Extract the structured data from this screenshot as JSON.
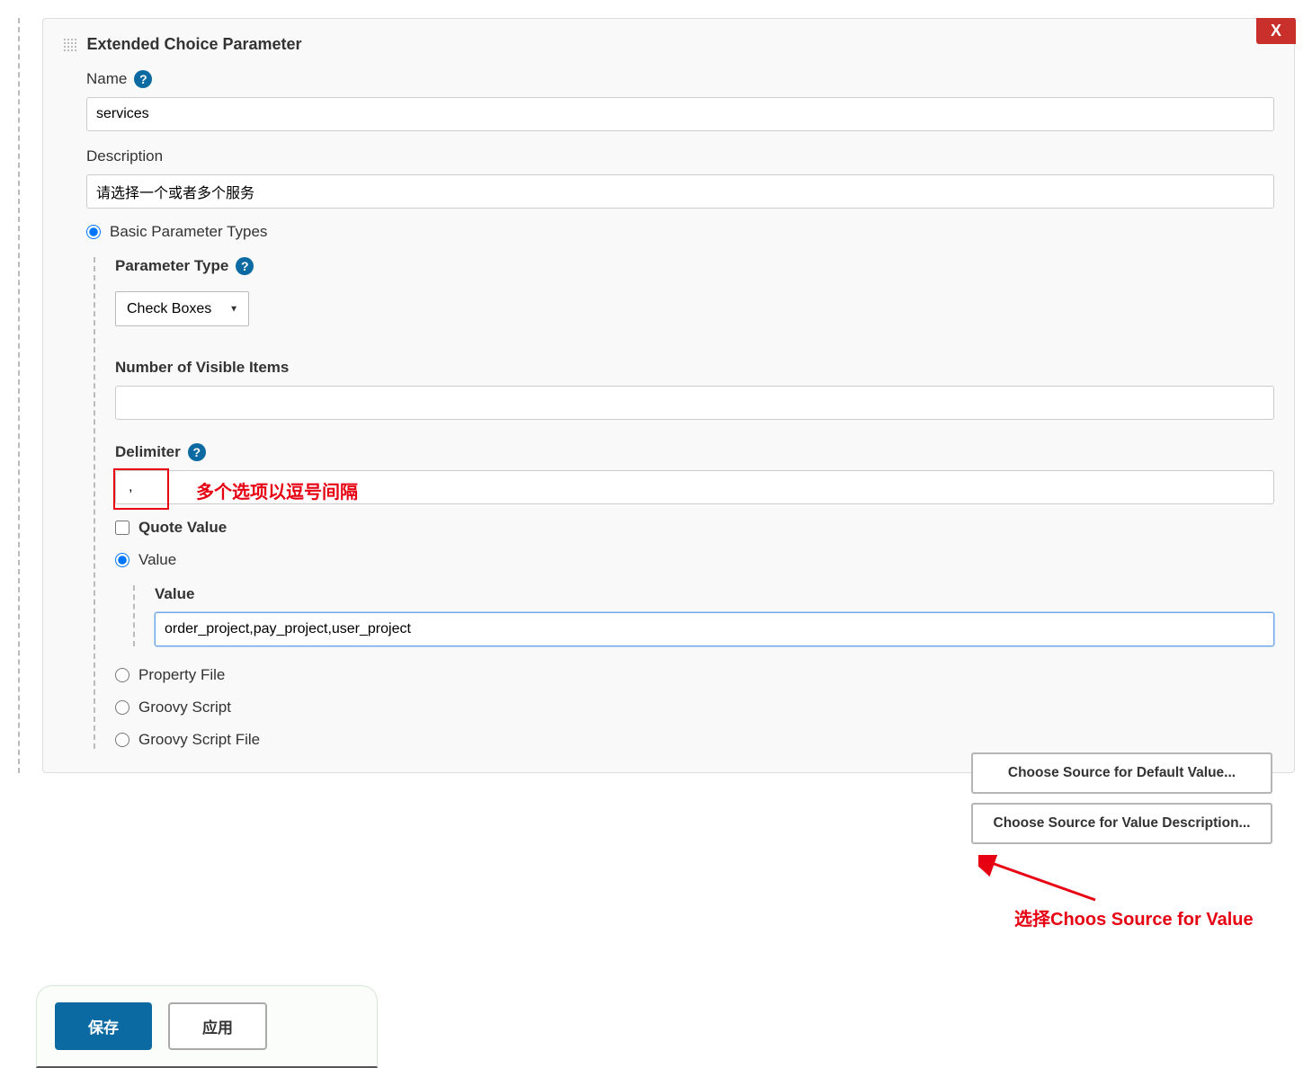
{
  "panel": {
    "title": "Extended Choice Parameter",
    "close": "X"
  },
  "fields": {
    "name_label": "Name",
    "name_value": "services",
    "description_label": "Description",
    "description_value": "请选择一个或者多个服务",
    "basic_parameter_types": "Basic Parameter Types",
    "parameter_type_label": "Parameter Type",
    "parameter_type_value": "Check Boxes",
    "num_visible_label": "Number of Visible Items",
    "num_visible_value": "",
    "delimiter_label": "Delimiter",
    "delimiter_value": ",",
    "quote_value": "Quote Value",
    "value_radio": "Value",
    "value_label": "Value",
    "value_input": "order_project,pay_project,user_project",
    "property_file": "Property File",
    "groovy_script": "Groovy Script",
    "groovy_script_file": "Groovy Script File"
  },
  "annotations": {
    "delimiter_note": "多个选项以逗号间隔",
    "source_note": "选择Choos Source for Value"
  },
  "buttons": {
    "choose_default": "Choose Source for Default Value...",
    "choose_desc": "Choose Source for Value Description...",
    "save": "保存",
    "apply": "应用"
  }
}
